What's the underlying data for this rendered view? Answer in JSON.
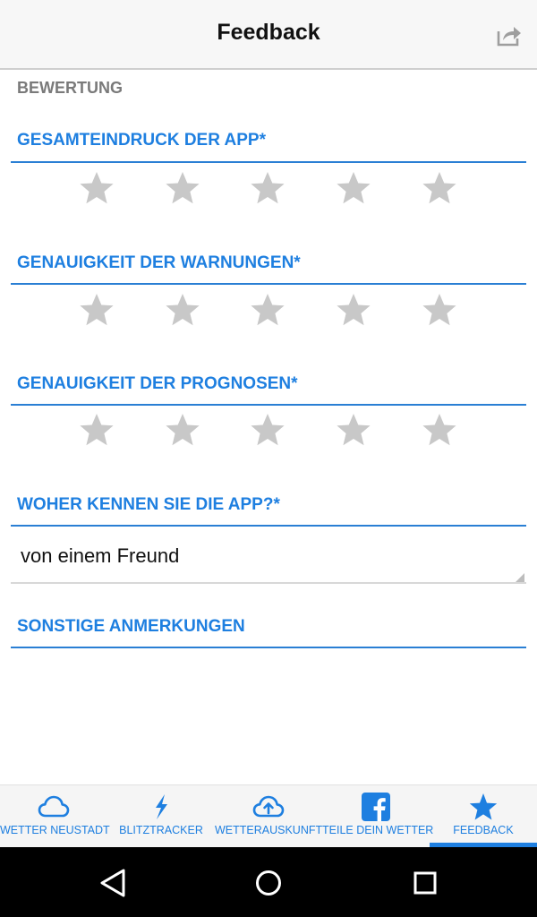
{
  "header": {
    "title": "Feedback",
    "share_icon": "share-icon"
  },
  "section": {
    "label": "BEWERTUNG"
  },
  "questions": [
    {
      "title": "GESAMTEINDRUCK DER APP*",
      "rating": 0,
      "max": 5
    },
    {
      "title": "GENAUIGKEIT DER WARNUNGEN*",
      "rating": 0,
      "max": 5
    },
    {
      "title": "GENAUIGKEIT DER PROGNOSEN*",
      "rating": 0,
      "max": 5
    }
  ],
  "source": {
    "title": "WOHER KENNEN SIE DIE APP?*",
    "selected": "von einem Freund"
  },
  "remarks": {
    "title": "SONSTIGE ANMERKUNGEN"
  },
  "colors": {
    "accent": "#1e7fe0",
    "star_inactive": "#c8c8c8",
    "section_gray": "#7a7a7a"
  },
  "tabs": [
    {
      "label": "WETTER NEUSTADT",
      "icon": "cloud-icon",
      "active": false
    },
    {
      "label": "BLITZTRACKER",
      "icon": "lightning-icon",
      "active": false
    },
    {
      "label": "WETTERAUSKUNFT",
      "icon": "cloud-upload-icon",
      "active": false
    },
    {
      "label": "TEILE DEIN WETTER",
      "icon": "facebook-icon",
      "active": false
    },
    {
      "label": "FEEDBACK",
      "icon": "star-icon",
      "active": true
    }
  ],
  "nav": {
    "back": "back-icon",
    "home": "home-icon",
    "recents": "recents-icon"
  }
}
